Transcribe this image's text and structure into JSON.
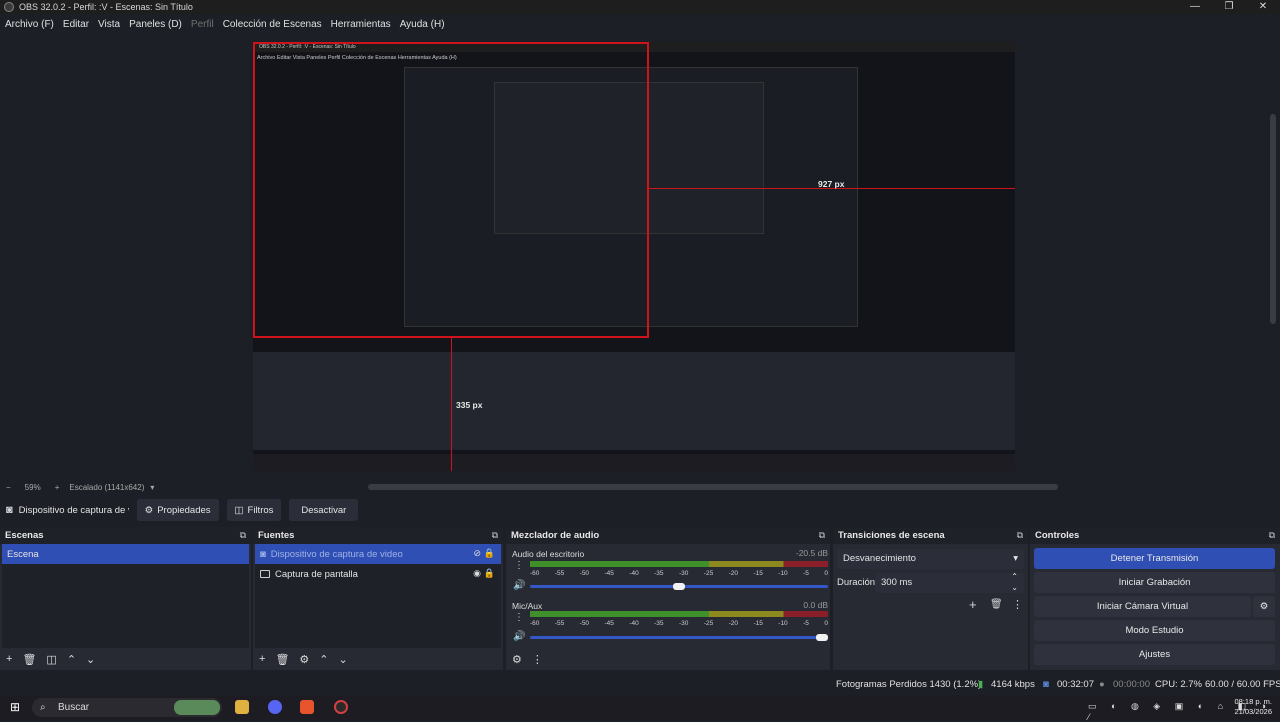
{
  "window": {
    "title": "OBS 32.0.2 - Perfil: :V - Escenas: Sin Título",
    "controls": [
      "—",
      "❐",
      "✕"
    ]
  },
  "menu": [
    "Archivo (F)",
    "Editar",
    "Vista",
    "Paneles (D)",
    "Perfil",
    "Colección de Escenas",
    "Herramientas",
    "Ayuda (H)"
  ],
  "preview": {
    "nested_title": "OBS 32.0.2 - Perfil: :V - Escenas: Sin Título",
    "nested_menu": "Archivo   Editar   Vista   Paneles   Perfil   Colección de Escenas   Herramientas   Ayuda (H)",
    "measure_right": "927 px",
    "measure_bottom": "335 px"
  },
  "zoombar": {
    "minus": "−",
    "zoom": "59%",
    "plus": "+",
    "scale": "Escalado (1141x642)"
  },
  "source_toolbar": {
    "source_name": "Dispositivo de captura de v",
    "properties": "Propiedades",
    "filters": "Filtros",
    "deactivate": "Desactivar"
  },
  "scenes": {
    "title": "Escenas",
    "items": [
      "Escena"
    ]
  },
  "sources": {
    "title": "Fuentes",
    "items": [
      "Dispositivo de captura de video",
      "Captura de pantalla"
    ]
  },
  "mixer": {
    "title": "Mezclador de audio",
    "channels": [
      {
        "name": "Audio del escritorio",
        "db": "-20.5 dB",
        "level": 0.48,
        "volume": 0.5
      },
      {
        "name": "Mic/Aux",
        "db": "0.0 dB",
        "level": 0.04,
        "volume": 1.0
      }
    ],
    "ticks": [
      "-60",
      "-55",
      "-50",
      "-45",
      "-40",
      "-35",
      "-30",
      "-25",
      "-20",
      "-15",
      "-10",
      "-5",
      "0"
    ]
  },
  "transitions": {
    "title": "Transiciones de escena",
    "selected": "Desvanecimiento",
    "duration_label": "Duración",
    "duration_value": "300 ms"
  },
  "controls": {
    "title": "Controles",
    "buttons": [
      "Detener Transmisión",
      "Iniciar Grabación",
      "Iniciar Cámara Virtual",
      "Modo Estudio",
      "Ajustes"
    ]
  },
  "status": {
    "dropped": "Fotogramas Perdidos 1430 (1.2%)",
    "bitrate": "4164 kbps",
    "stream_time": "00:32:07",
    "rec_time": "00:00:00",
    "cpu": "CPU: 2.7%",
    "fps": "60.00 / 60.00 FPS"
  },
  "taskbar": {
    "search": "Buscar",
    "time": "08:18 p. m.",
    "date": "21/03/2026"
  },
  "colors": {
    "accent": "#2f4fb4",
    "red_guide": "#d0121b",
    "meter_green": "#3f8f2b"
  }
}
